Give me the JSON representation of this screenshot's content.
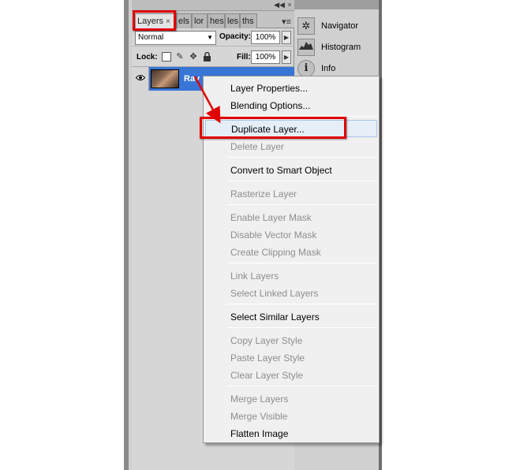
{
  "panel": {
    "tabs": [
      {
        "label": "Layers",
        "close": "×"
      },
      {
        "label": "els"
      },
      {
        "label": "lor"
      },
      {
        "label": "hes"
      },
      {
        "label": "les"
      },
      {
        "label": "ths"
      }
    ],
    "minimize": "◀◀",
    "close": "×",
    "menu_glyph": "▾≡",
    "blend_mode": "Normal",
    "opacity_label": "Opacity:",
    "opacity_value": "100%",
    "lock_label": "Lock:",
    "fill_label": "Fill:",
    "fill_value": "100%",
    "layer_name": "Rav"
  },
  "dock": {
    "items": [
      {
        "label": "Navigator",
        "icon": "navigator-icon"
      },
      {
        "label": "Histogram",
        "icon": "histogram-icon"
      },
      {
        "label": "Info",
        "icon": "info-icon"
      }
    ]
  },
  "context_menu": {
    "items": [
      {
        "label": "Layer Properties...",
        "enabled": true
      },
      {
        "label": "Blending Options...",
        "enabled": true
      },
      {
        "label": "Duplicate Layer...",
        "enabled": true,
        "highlighted": true
      },
      {
        "label": "Delete Layer",
        "enabled": false
      },
      {
        "label": "Convert to Smart Object",
        "enabled": true
      },
      {
        "label": "Rasterize Layer",
        "enabled": false
      },
      {
        "label": "Enable Layer Mask",
        "enabled": false
      },
      {
        "label": "Disable Vector Mask",
        "enabled": false
      },
      {
        "label": "Create Clipping Mask",
        "enabled": false
      },
      {
        "label": "Link Layers",
        "enabled": false
      },
      {
        "label": "Select Linked Layers",
        "enabled": false
      },
      {
        "label": "Select Similar Layers",
        "enabled": true
      },
      {
        "label": "Copy Layer Style",
        "enabled": false
      },
      {
        "label": "Paste Layer Style",
        "enabled": false
      },
      {
        "label": "Clear Layer Style",
        "enabled": false
      },
      {
        "label": "Merge Layers",
        "enabled": false
      },
      {
        "label": "Merge Visible",
        "enabled": false
      },
      {
        "label": "Flatten Image",
        "enabled": true
      }
    ]
  },
  "colors": {
    "annotation": "#e00000",
    "selection": "#3875d7"
  }
}
